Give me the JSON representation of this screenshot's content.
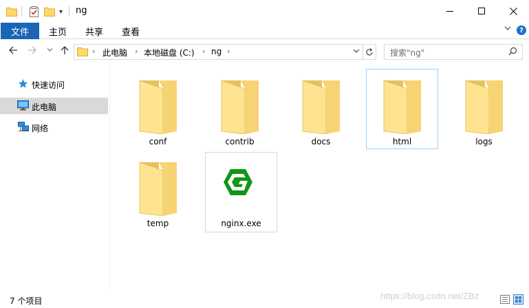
{
  "window": {
    "title": "ng",
    "quick_access_dropdown": "▾"
  },
  "ribbon": {
    "file": "文件",
    "home": "主页",
    "share": "共享",
    "view": "查看",
    "help": "?"
  },
  "address": {
    "crumbs": [
      "此电脑",
      "本地磁盘 (C:)",
      "ng"
    ]
  },
  "search": {
    "placeholder": "搜索\"ng\""
  },
  "nav_pane": {
    "items": [
      {
        "label": "快速访问",
        "icon": "star-icon"
      },
      {
        "label": "此电脑",
        "icon": "computer-icon",
        "selected": true
      },
      {
        "label": "网络",
        "icon": "network-icon"
      }
    ]
  },
  "files": [
    {
      "name": "conf",
      "type": "folder"
    },
    {
      "name": "contrib",
      "type": "folder"
    },
    {
      "name": "docs",
      "type": "folder"
    },
    {
      "name": "html",
      "type": "folder",
      "selected": true
    },
    {
      "name": "logs",
      "type": "folder"
    },
    {
      "name": "temp",
      "type": "folder"
    },
    {
      "name": "nginx.exe",
      "type": "exe",
      "icon": "nginx-icon"
    }
  ],
  "status": {
    "item_count": "7 个项目",
    "watermark": "https://blog.csdn.net/ZBz"
  },
  "colors": {
    "file_tab": "#1a65b5",
    "folder_light": "#ffe28e",
    "folder_dark": "#e4bf5b",
    "nginx_green": "#119619",
    "selection_border": "#99d1ff",
    "nav_selected": "#d9d9d9"
  }
}
